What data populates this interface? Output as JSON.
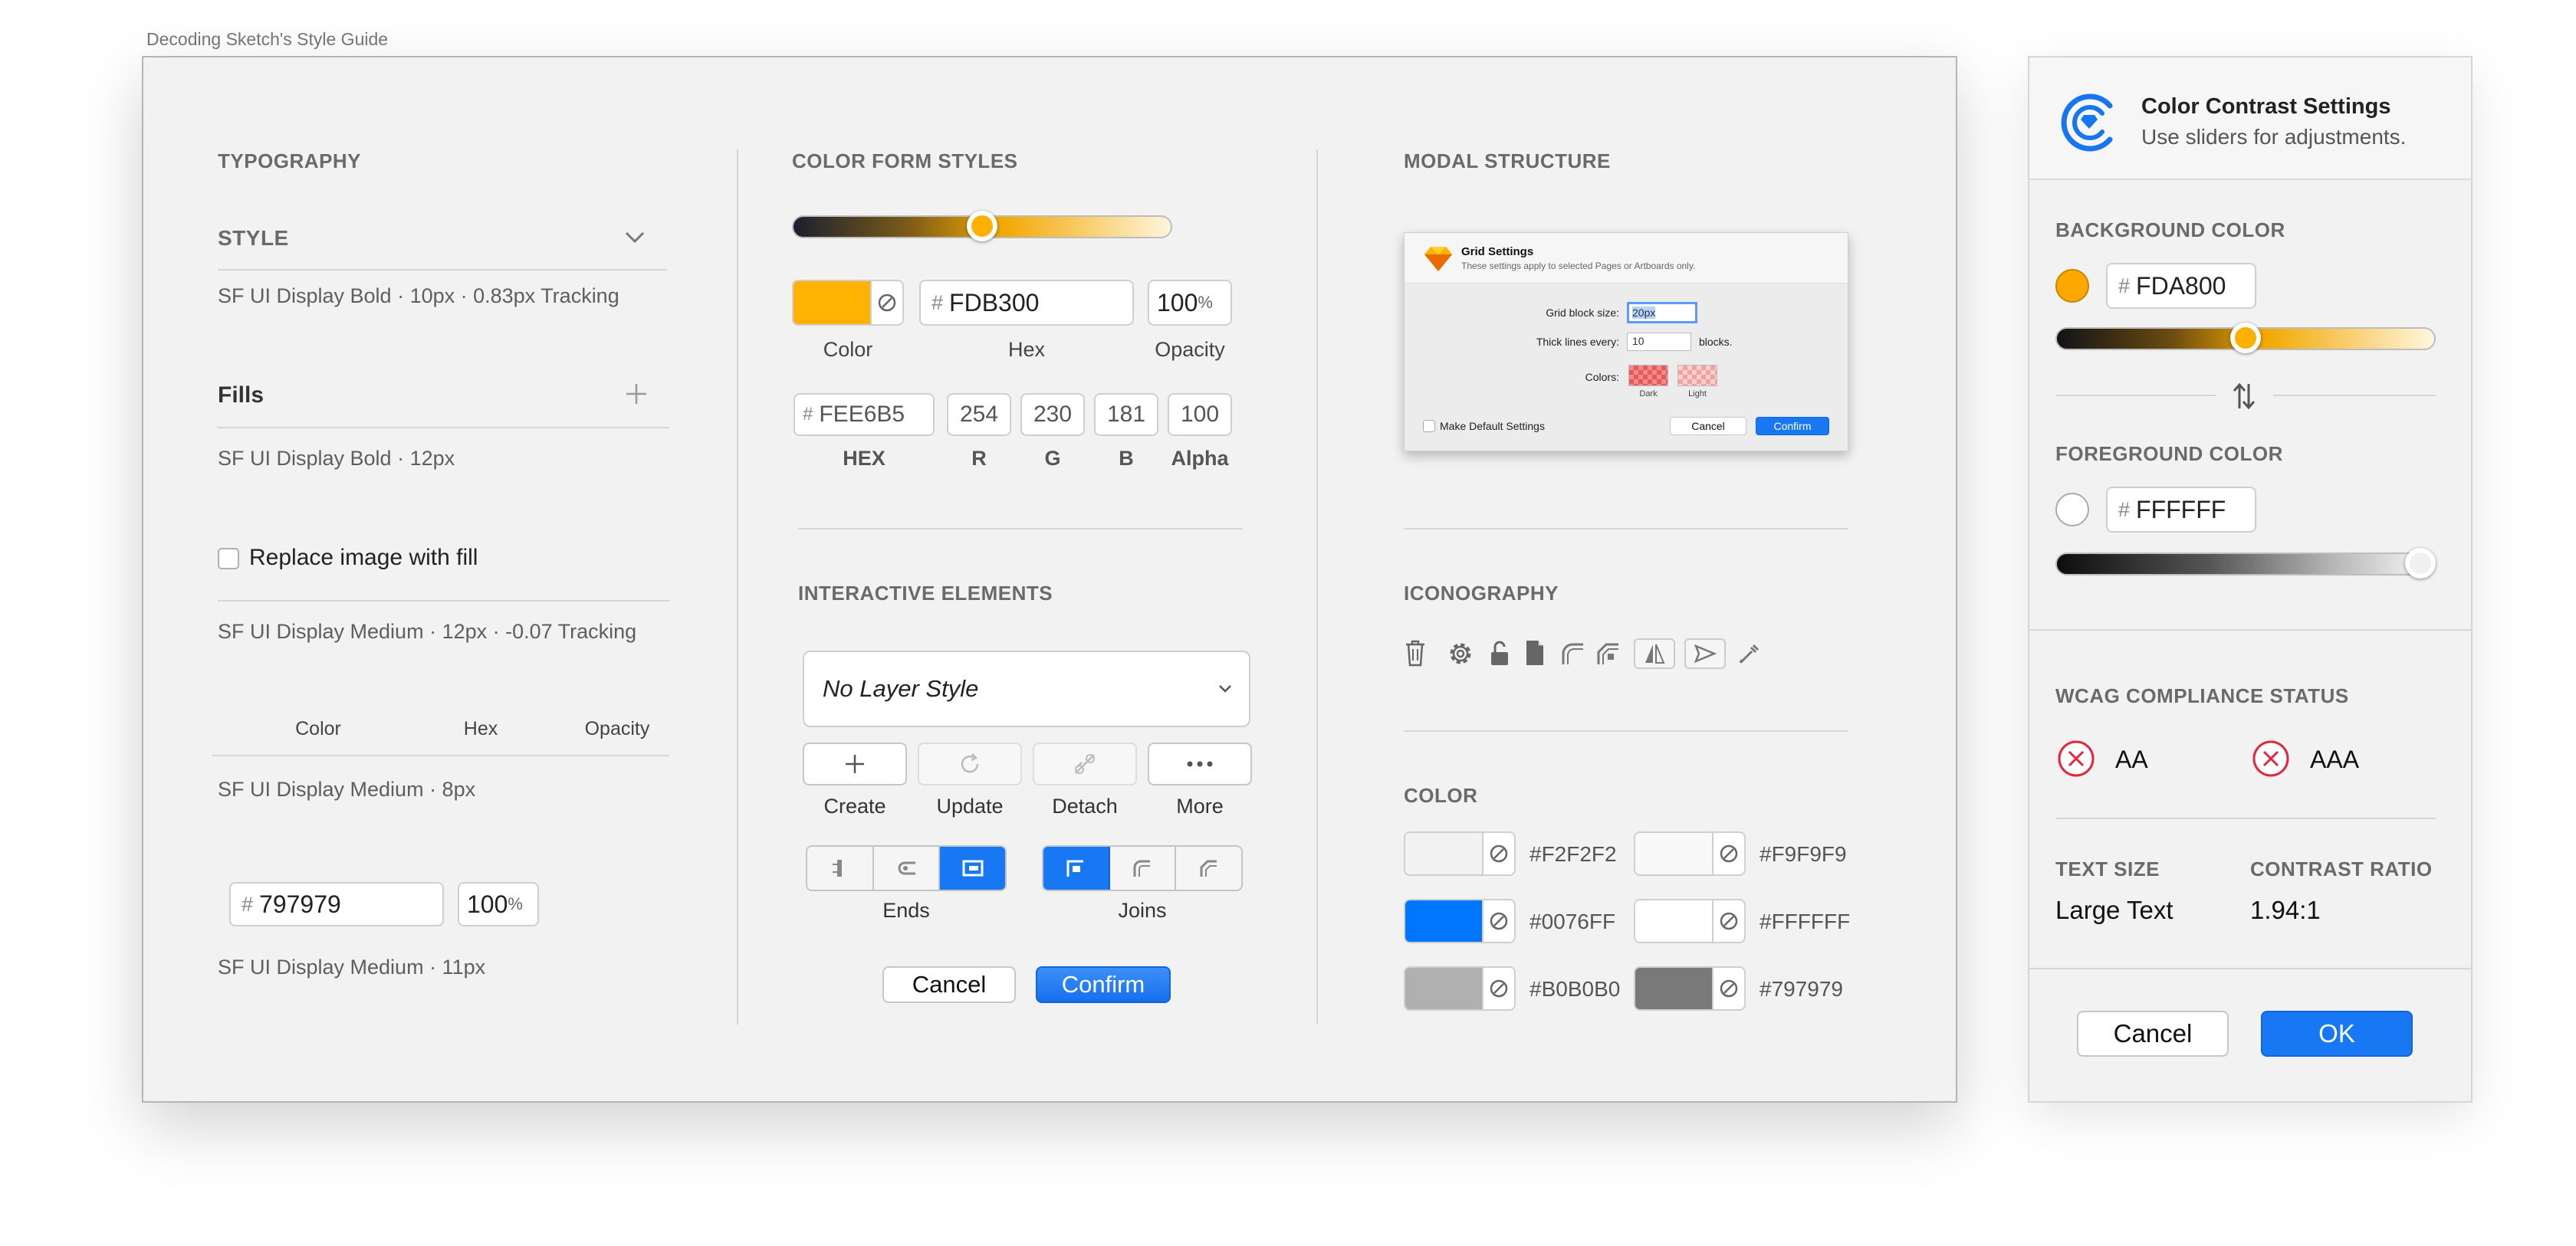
{
  "caption": "Decoding Sketch's Style Guide",
  "typography": {
    "title": "TYPOGRAPHY",
    "style_label": "STYLE",
    "note1": "SF UI Display Bold · 10px · 0.83px Tracking",
    "fills_label": "Fills",
    "note2": "SF UI Display Bold · 12px",
    "replace_label": "Replace image with fill",
    "note3": "SF UI Display Medium · 12px · -0.07 Tracking",
    "col_color": "Color",
    "col_hex": "Hex",
    "col_opacity": "Opacity",
    "note4": "SF UI Display Medium · 8px",
    "hex_value": "797979",
    "opacity_value": "100",
    "percent": "%",
    "note5": "SF UI Display Medium · 11px"
  },
  "color_form": {
    "title": "COLOR FORM STYLES",
    "slider_level": 0.5,
    "swatch_color": "#FDB300",
    "hex_value": "FDB300",
    "opacity_value": "100",
    "percent": "%",
    "lbl_color": "Color",
    "lbl_hex": "Hex",
    "lbl_opacity": "Opacity",
    "hex2_value": "FEE6B5",
    "r": "254",
    "g": "230",
    "b": "181",
    "alpha": "100",
    "lbl_HEX": "HEX",
    "lbl_r": "R",
    "lbl_g": "G",
    "lbl_b": "B",
    "lbl_alpha": "Alpha"
  },
  "interactive": {
    "title": "INTERACTIVE ELEMENTS",
    "dropdown_value": "No Layer Style",
    "create": "Create",
    "update": "Update",
    "detach": "Detach",
    "more": "More",
    "ends": "Ends",
    "joins": "Joins",
    "cancel": "Cancel",
    "confirm": "Confirm"
  },
  "modal": {
    "title": "MODAL STRUCTURE",
    "dlg_title": "Grid Settings",
    "dlg_sub": "These settings apply to selected Pages or Artboards only.",
    "block_label": "Grid block size:",
    "block_value": "20px",
    "thick_label": "Thick lines every:",
    "thick_value": "10",
    "thick_unit": "blocks.",
    "colors_label": "Colors:",
    "dark": "Dark",
    "light": "Light",
    "default_label": "Make Default Settings",
    "cancel": "Cancel",
    "confirm": "Confirm"
  },
  "iconography": {
    "title": "ICONOGRAPHY",
    "icons": [
      "trash-icon",
      "gear-icon",
      "unlock-icon",
      "document-icon",
      "rounded-corner-icon",
      "bevel-corner-icon",
      "flip-icon",
      "send-icon",
      "eyedropper-icon"
    ]
  },
  "color": {
    "title": "COLOR",
    "swatches": [
      {
        "hex": "#F2F2F2"
      },
      {
        "hex": "#F9F9F9"
      },
      {
        "hex": "#0076FF"
      },
      {
        "hex": "#FFFFFF"
      },
      {
        "hex": "#B0B0B0"
      },
      {
        "hex": "#797979"
      }
    ]
  },
  "contrast": {
    "title": "Color Contrast Settings",
    "subtitle": "Use sliders for adjustments.",
    "bg_label": "BACKGROUND COLOR",
    "bg_color": "#FDA800",
    "bg_hex": "FDA800",
    "bg_level": 0.5,
    "fg_label": "FOREGROUND COLOR",
    "fg_color": "#FFFFFF",
    "fg_hex": "FFFFFF",
    "fg_level": 1.0,
    "wcag_label": "WCAG COMPLIANCE STATUS",
    "aa": "AA",
    "aaa": "AAA",
    "text_size_label": "TEXT SIZE",
    "text_size_value": "Large Text",
    "ratio_label": "CONTRAST RATIO",
    "ratio_value": "1.94:1",
    "cancel": "Cancel",
    "ok": "OK"
  }
}
